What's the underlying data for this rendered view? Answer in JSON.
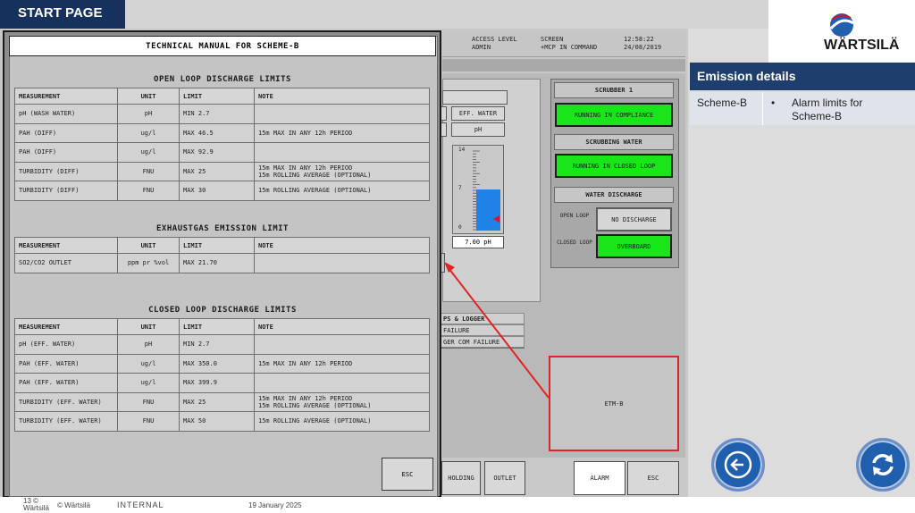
{
  "slide": {
    "start_tab": "START PAGE",
    "brand": "WÄRTSILÄ",
    "footer": {
      "page_number": "13",
      "copyright_symbol": "©",
      "copyright_name": "Wärtsilä",
      "copyright_text": "© Wärtsilä",
      "classification": "INTERNAL",
      "date": "19 January 2025"
    }
  },
  "hmi": {
    "header": {
      "access_level_label": "ACCESS LEVEL",
      "access_level_value": "ADMIN",
      "screen_label": "SCREEN",
      "screen_value": "+MCP IN COMMAND",
      "time": "12:58:22",
      "date": "24/08/2019"
    },
    "buttons": {
      "eff_water": "EFF. WATER",
      "ph": "pH"
    },
    "gauge": {
      "ticks": [
        "14",
        "7",
        "0"
      ],
      "max": 14,
      "value": 7.0,
      "value_label": "7.00 pH"
    },
    "status": {
      "scrubber_title": "SCRUBBER 1",
      "scrubber_state": "RUNNING IN COMPLIANCE",
      "scrubbing_water_title": "SCRUBBING WATER",
      "scrubbing_water_state": "RUNNING IN CLOSED LOOP",
      "water_discharge_title": "WATER DISCHARGE",
      "open_loop_label": "OPEN LOOP",
      "open_loop_state": "NO DISCHARGE",
      "closed_loop_label": "CLOSED LOOP",
      "closed_loop_state": "OVERBOARD"
    },
    "logger": {
      "title": "PS & LOGGER",
      "rows": [
        "FAILURE",
        "GER COM FAILURE"
      ]
    },
    "etm_label": "ETM-B",
    "bottom_buttons": {
      "holding": "HOLDING",
      "outlet": "OUTLET",
      "alarm": "ALARM",
      "esc": "ESC"
    }
  },
  "manual": {
    "title": "TECHNICAL MANUAL FOR SCHEME-B",
    "esc": "ESC",
    "columns": [
      "MEASUREMENT",
      "UNIT",
      "LIMIT",
      "NOTE"
    ],
    "open_loop": {
      "title": "OPEN LOOP DISCHARGE LIMITS",
      "rows": [
        {
          "measurement": "pH (WASH WATER)",
          "unit": "pH",
          "limit": "MIN 2.7",
          "note1": "",
          "note2": ""
        },
        {
          "measurement": "PAH (DIFF)",
          "unit": "ug/l",
          "limit": "MAX 46.5",
          "note1": "15m MAX IN ANY 12h PERIOD",
          "note2": ""
        },
        {
          "measurement": "PAH (DIFF)",
          "unit": "ug/l",
          "limit": "MAX 92.9",
          "note1": "",
          "note2": ""
        },
        {
          "measurement": "TURBIDITY (DIFF)",
          "unit": "FNU",
          "limit": "MAX 25",
          "note1": "15m MAX IN ANY 12h PERIOD",
          "note2": "15m ROLLING AVERAGE (OPTIONAL)"
        },
        {
          "measurement": "TURBIDITY (DIFF)",
          "unit": "FNU",
          "limit": "MAX 30",
          "note1": "15m ROLLING AVERAGE (OPTIONAL)",
          "note2": ""
        }
      ]
    },
    "exhaust": {
      "title": "EXHAUSTGAS EMISSION LIMIT",
      "rows": [
        {
          "measurement": "SO2/CO2 OUTLET",
          "unit": "ppm pr %vol",
          "limit": "MAX 21.70",
          "note1": "",
          "note2": ""
        }
      ]
    },
    "closed_loop": {
      "title": "CLOSED LOOP DISCHARGE LIMITS",
      "rows": [
        {
          "measurement": "pH (EFF. WATER)",
          "unit": "pH",
          "limit": "MIN 2.7",
          "note1": "",
          "note2": ""
        },
        {
          "measurement": "PAH (EFF. WATER)",
          "unit": "ug/l",
          "limit": "MAX 350.0",
          "note1": "15m MAX IN ANY 12h PERIOD",
          "note2": ""
        },
        {
          "measurement": "PAH (EFF. WATER)",
          "unit": "ug/l",
          "limit": "MAX 399.9",
          "note1": "",
          "note2": ""
        },
        {
          "measurement": "TURBIDITY (EFF. WATER)",
          "unit": "FNU",
          "limit": "MAX 25",
          "note1": "15m MAX IN ANY 12h PERIOD",
          "note2": "15m ROLLING AVERAGE (OPTIONAL)"
        },
        {
          "measurement": "TURBIDITY (EFF. WATER)",
          "unit": "FNU",
          "limit": "MAX 50",
          "note1": "15m ROLLING AVERAGE (OPTIONAL)",
          "note2": ""
        }
      ]
    }
  },
  "panel": {
    "title": "Emission details",
    "scheme": "Scheme-B",
    "bullet": "•",
    "description": "Alarm limits for Scheme-B"
  },
  "icons": {
    "back": "back-arrow-icon",
    "refresh": "refresh-icon"
  },
  "colors": {
    "navy": "#16325c",
    "panel_header": "#1e3f6e",
    "green_status": "#19e619",
    "gauge_blue": "#1e82e6",
    "highlight_red": "#e02424"
  }
}
